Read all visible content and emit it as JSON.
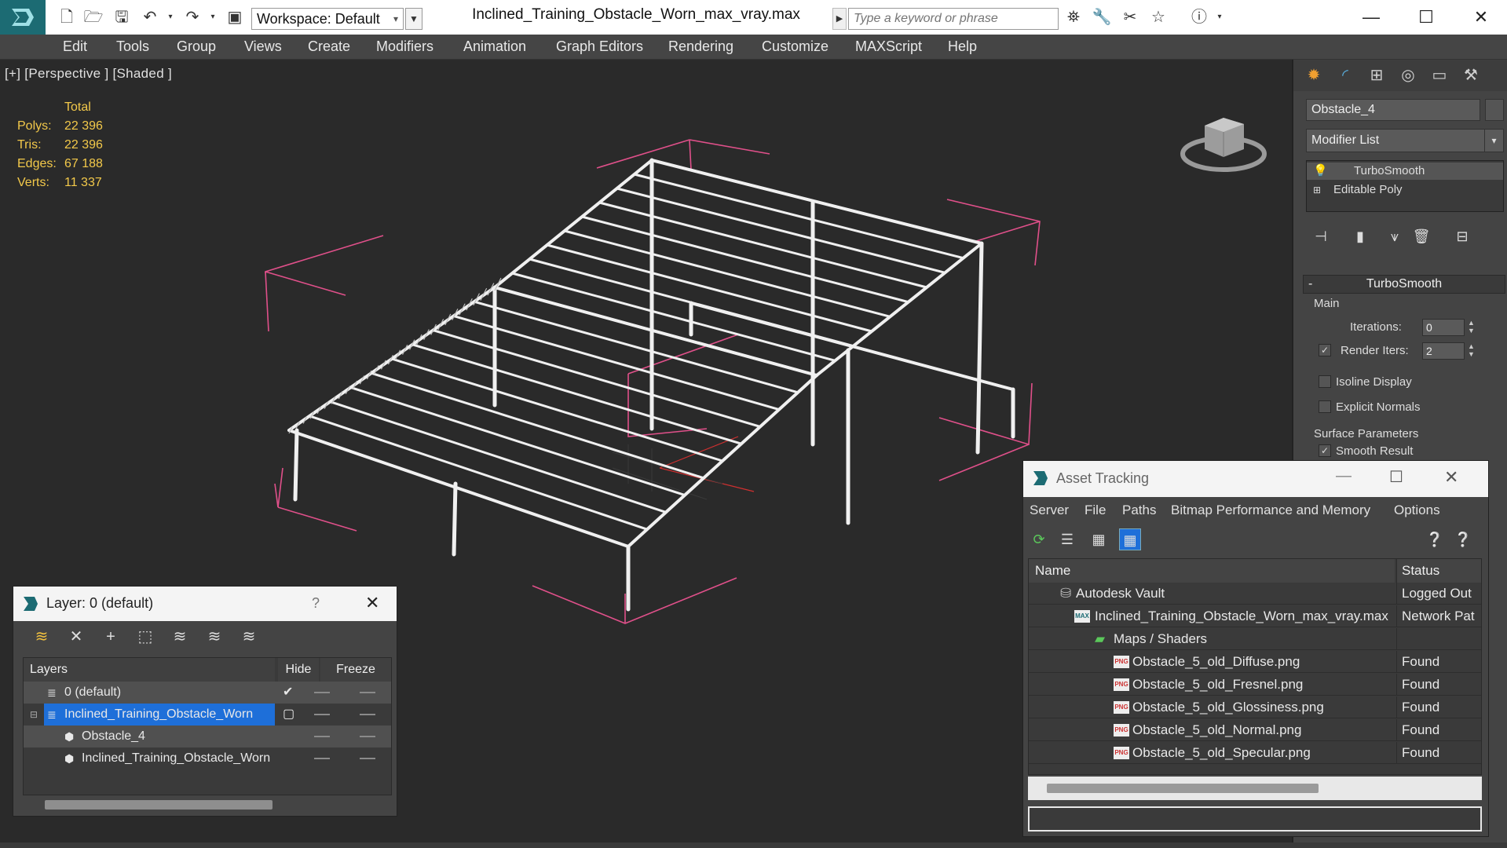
{
  "titlebar": {
    "workspace_label": "Workspace: Default",
    "file_title": "Inclined_Training_Obstacle_Worn_max_vray.max",
    "search_placeholder": "Type a keyword or phrase",
    "icons": [
      "new-file-icon",
      "open-file-icon",
      "save-icon",
      "undo-icon",
      "redo-icon",
      "project-icon",
      "binoculars-icon",
      "tools-icon",
      "sign-in-icon",
      "star-icon",
      "help-icon"
    ]
  },
  "menubar": {
    "items": [
      "Edit",
      "Tools",
      "Group",
      "Views",
      "Create",
      "Modifiers",
      "Animation",
      "Graph Editors",
      "Rendering",
      "Customize",
      "MAXScript",
      "Help"
    ]
  },
  "viewport": {
    "label": "[+] [Perspective ] [Shaded ]",
    "stats": {
      "header": "Total",
      "rows": [
        {
          "label": "Polys:",
          "value": "22 396"
        },
        {
          "label": "Tris:",
          "value": "22 396"
        },
        {
          "label": "Edges:",
          "value": "67 188"
        },
        {
          "label": "Verts:",
          "value": "11 337"
        }
      ]
    },
    "wire_color": "#f0f0f0",
    "bbox_color": "#e0508a"
  },
  "command_panel": {
    "object_name": "Obstacle_4",
    "modifier_list": "Modifier List",
    "stack": [
      "TurboSmooth",
      "Editable Poly"
    ],
    "rollout": {
      "title": "TurboSmooth",
      "main_group": "Main",
      "iterations_label": "Iterations:",
      "iterations_value": "0",
      "render_iters_label": "Render Iters:",
      "render_iters_value": "2",
      "isoline_label": "Isoline Display",
      "explicit_normals_label": "Explicit Normals",
      "surface_group": "Surface Parameters",
      "smooth_result_label": "Smooth Result"
    }
  },
  "layer_dialog": {
    "title": "Layer: 0 (default)",
    "help": "?",
    "columns": {
      "layers": "Layers",
      "hide": "Hide",
      "freeze": "Freeze"
    },
    "rows": [
      {
        "name": "0 (default)",
        "selected": false
      },
      {
        "name": "Inclined_Training_Obstacle_Worn",
        "selected": true
      },
      {
        "name": "Obstacle_4",
        "selected": false
      },
      {
        "name": "Inclined_Training_Obstacle_Worn",
        "selected": false
      }
    ]
  },
  "asset_dialog": {
    "title": "Asset Tracking",
    "menu": [
      "Server",
      "File",
      "Paths",
      "Bitmap Performance and Memory",
      "Options"
    ],
    "columns": {
      "name": "Name",
      "status": "Status"
    },
    "rows": [
      {
        "name": "Autodesk Vault",
        "status": "Logged Out"
      },
      {
        "name": "Inclined_Training_Obstacle_Worn_max_vray.max",
        "status": "Network Pat"
      },
      {
        "name": "Maps / Shaders",
        "status": ""
      },
      {
        "name": "Obstacle_5_old_Diffuse.png",
        "status": "Found"
      },
      {
        "name": "Obstacle_5_old_Fresnel.png",
        "status": "Found"
      },
      {
        "name": "Obstacle_5_old_Glossiness.png",
        "status": "Found"
      },
      {
        "name": "Obstacle_5_old_Normal.png",
        "status": "Found"
      },
      {
        "name": "Obstacle_5_old_Specular.png",
        "status": "Found"
      }
    ],
    "png_badge": "PNG",
    "max_badge": "MAX"
  }
}
